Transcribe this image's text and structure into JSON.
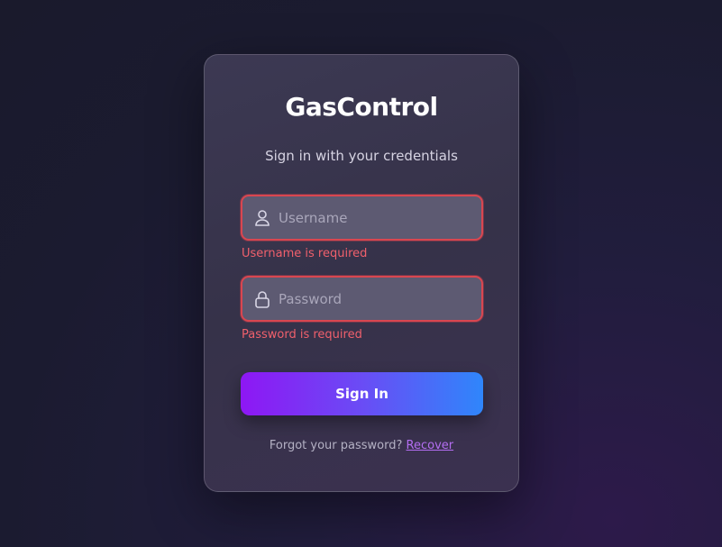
{
  "app": {
    "title": "GasControl",
    "subtitle": "Sign in with your credentials"
  },
  "form": {
    "username": {
      "value": "",
      "placeholder": "Username",
      "icon": "user-icon",
      "error": "Username is required"
    },
    "password": {
      "value": "",
      "placeholder": "Password",
      "icon": "lock-icon",
      "error": "Password is required"
    },
    "submit_label": "Sign In"
  },
  "footer": {
    "prompt": "Forgot your password?",
    "link_label": "Recover"
  },
  "colors": {
    "error": "#f0606c",
    "gradient_start": "#8e17f4",
    "gradient_end": "#2f86fb",
    "link": "#b46ef2"
  }
}
